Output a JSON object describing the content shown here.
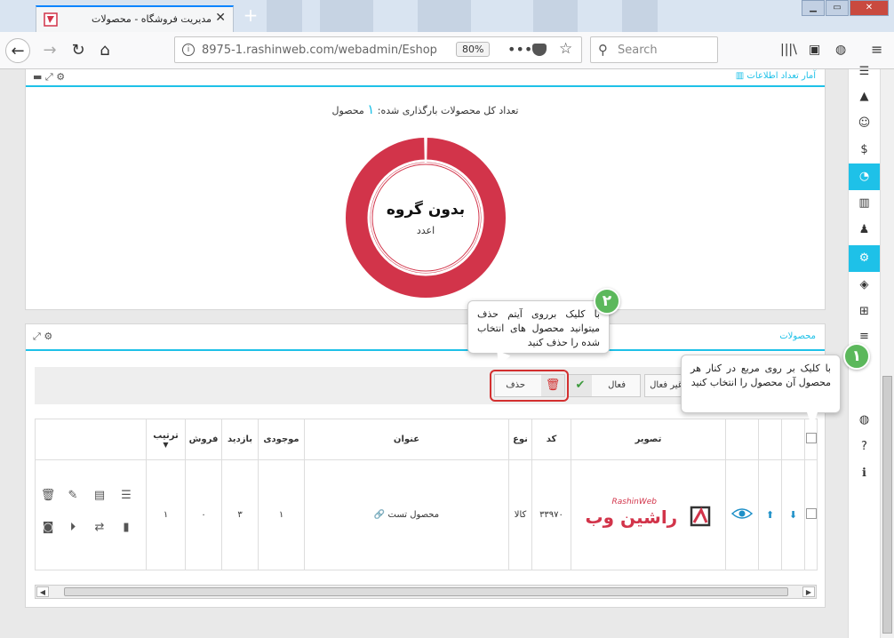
{
  "browser": {
    "tab_title": "مدیریت فروشگاه - محصولات",
    "url": "8975-1.rashinweb.com/webadmin/Eshop",
    "zoom": "80%",
    "search_placeholder": "Search"
  },
  "stats_panel": {
    "title": "آمار تعداد اطلاعات",
    "total_prefix": "تعداد کل محصولات بارگذاری شده:",
    "total_count": "۱",
    "total_suffix": "محصول",
    "donut_label": "بدون گروه",
    "donut_sublabel": "اعدد"
  },
  "chart_data": {
    "type": "pie",
    "categories": [
      "بدون گروه"
    ],
    "values": [
      1
    ],
    "colors": [
      "#d2344a"
    ]
  },
  "products_panel": {
    "title": "محصولات",
    "buttons": {
      "inactive": "غیر فعال",
      "active": "فعال",
      "delete": "حذف"
    },
    "columns": [
      "تصویر",
      "کد",
      "نوع",
      "عنوان",
      "موجودی",
      "بازدید",
      "فروش",
      "ترتیب"
    ],
    "rows": [
      {
        "code": "۳۳۹۷۰",
        "type": "کالا",
        "title": "محصول تست",
        "stock": "۱",
        "views": "۳",
        "sales": "۰",
        "order": "۱",
        "logo_text": "راشین وب",
        "logo_sub": "RashinWeb"
      }
    ]
  },
  "tooltips": {
    "one": {
      "badge": "۱",
      "text": "با کلیک بر روی مربع در کنار هر محصول آن محصول را انتخاب کنید"
    },
    "two": {
      "badge": "۲",
      "text": "با کلیک برروی آیتم حذف میتوانید محصول های انتخاب شده را حذف کنید"
    }
  },
  "colors": {
    "accent": "#1ec1e8",
    "donut": "#d2344a",
    "delete": "#d32f2f",
    "badge": "#5cb85c"
  }
}
